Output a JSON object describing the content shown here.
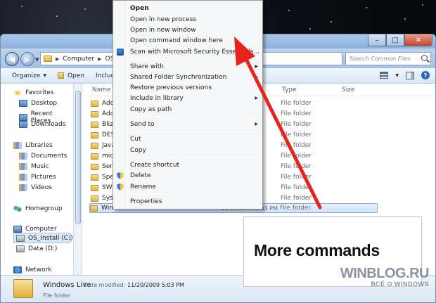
{
  "address": {
    "segments": [
      "Computer",
      "OS_In"
    ],
    "search_placeholder": "Search Common Files"
  },
  "toolbar": {
    "organize": "Organize",
    "open": "Open",
    "include": "Includ"
  },
  "nav": {
    "favorites": "Favorites",
    "desktop": "Desktop",
    "recent": "Recent Places",
    "downloads": "Downloads",
    "libraries": "Libraries",
    "documents": "Documents",
    "music": "Music",
    "pictures": "Pictures",
    "videos": "Videos",
    "homegroup": "Homegroup",
    "computer": "Computer",
    "os_install": "OS_Install (C:)",
    "data": "Data (D:)",
    "network": "Network"
  },
  "columns": {
    "name": "Name",
    "type": "Type",
    "size": "Size"
  },
  "rows": [
    {
      "name": "Ado",
      "date": "AM",
      "type": "File folder"
    },
    {
      "name": "Ado",
      "date": "AM",
      "type": "File folder"
    },
    {
      "name": "Blizz",
      "date": "AM",
      "type": "File folder"
    },
    {
      "name": "DES",
      "date": "PM",
      "type": "File folder"
    },
    {
      "name": "Java",
      "date": "PM",
      "type": "File folder"
    },
    {
      "name": "mic",
      "date": "AM",
      "type": "File folder"
    },
    {
      "name": "Serv",
      "date": "PM",
      "type": "File folder"
    },
    {
      "name": "Spe",
      "date": "PM",
      "type": "File folder"
    },
    {
      "name": "SWF",
      "date": "PM",
      "type": "File folder"
    },
    {
      "name": "Syst",
      "date": "PM",
      "type": "File folder"
    },
    {
      "name": "Windows Live",
      "date": "11/20/2009 5:03 PM",
      "type": "File folder"
    }
  ],
  "details": {
    "name": "Windows Live",
    "modified_label": "Date modified:",
    "modified_value": "11/20/2009 5:03 PM",
    "type": "File folder"
  },
  "context_menu": {
    "open": "Open",
    "open_new_process": "Open in new process",
    "open_new_window": "Open in new window",
    "open_command_window": "Open command window here",
    "scan": "Scan with Microsoft Security Essentials...",
    "share_with": "Share with",
    "shared_sync": "Shared Folder Synchronization",
    "restore": "Restore previous versions",
    "include_library": "Include in library",
    "copy_as_path": "Copy as path",
    "send_to": "Send to",
    "cut": "Cut",
    "copy": "Copy",
    "create_shortcut": "Create shortcut",
    "delete": "Delete",
    "rename": "Rename",
    "properties": "Properties"
  },
  "caption": {
    "text": "More commands"
  },
  "watermark": {
    "main": "WINBLOG.RU",
    "sub": "ВСЁ О WINDOWS"
  },
  "colors": {
    "arrow": "#e8231e",
    "selection": "#cfe2fa",
    "window_frame": "#a9c7ea"
  }
}
